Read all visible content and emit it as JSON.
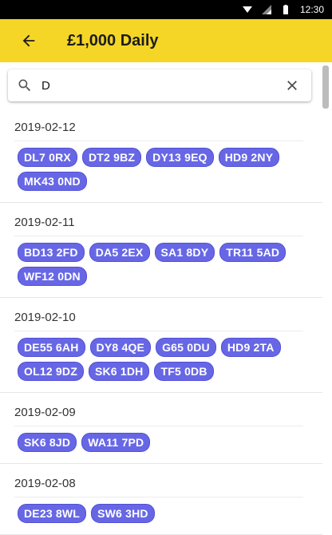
{
  "status": {
    "time": "12:30"
  },
  "appbar": {
    "title": "£1,000 Daily"
  },
  "search": {
    "value": "D"
  },
  "colors": {
    "appbar": "#F5D626",
    "chip": "#6767E6"
  },
  "groups": [
    {
      "date": "2019-02-12",
      "codes": [
        "DL7 0RX",
        "DT2 9BZ",
        "DY13 9EQ",
        "HD9 2NY",
        "MK43 0ND"
      ]
    },
    {
      "date": "2019-02-11",
      "codes": [
        "BD13 2FD",
        "DA5 2EX",
        "SA1 8DY",
        "TR11 5AD",
        "WF12 0DN"
      ]
    },
    {
      "date": "2019-02-10",
      "codes": [
        "DE55 6AH",
        "DY8 4QE",
        "G65 0DU",
        "HD9 2TA",
        "OL12 9DZ",
        "SK6 1DH",
        "TF5 0DB"
      ]
    },
    {
      "date": "2019-02-09",
      "codes": [
        "SK6 8JD",
        "WA11 7PD"
      ]
    },
    {
      "date": "2019-02-08",
      "codes": [
        "DE23 8WL",
        "SW6 3HD"
      ]
    }
  ]
}
